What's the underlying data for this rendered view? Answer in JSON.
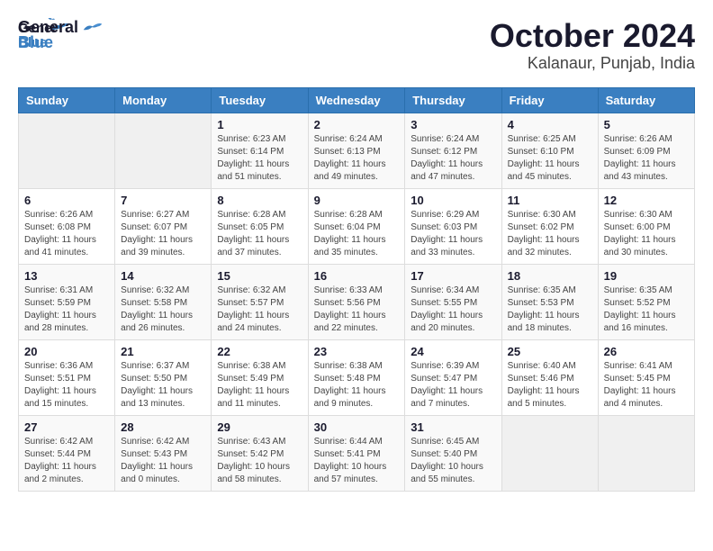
{
  "header": {
    "logo_general": "General",
    "logo_blue": "Blue",
    "month_title": "October 2024",
    "location": "Kalanaur, Punjab, India"
  },
  "weekdays": [
    "Sunday",
    "Monday",
    "Tuesday",
    "Wednesday",
    "Thursday",
    "Friday",
    "Saturday"
  ],
  "weeks": [
    [
      {
        "day": "",
        "sunrise": "",
        "sunset": "",
        "daylight": ""
      },
      {
        "day": "",
        "sunrise": "",
        "sunset": "",
        "daylight": ""
      },
      {
        "day": "1",
        "sunrise": "Sunrise: 6:23 AM",
        "sunset": "Sunset: 6:14 PM",
        "daylight": "Daylight: 11 hours and 51 minutes."
      },
      {
        "day": "2",
        "sunrise": "Sunrise: 6:24 AM",
        "sunset": "Sunset: 6:13 PM",
        "daylight": "Daylight: 11 hours and 49 minutes."
      },
      {
        "day": "3",
        "sunrise": "Sunrise: 6:24 AM",
        "sunset": "Sunset: 6:12 PM",
        "daylight": "Daylight: 11 hours and 47 minutes."
      },
      {
        "day": "4",
        "sunrise": "Sunrise: 6:25 AM",
        "sunset": "Sunset: 6:10 PM",
        "daylight": "Daylight: 11 hours and 45 minutes."
      },
      {
        "day": "5",
        "sunrise": "Sunrise: 6:26 AM",
        "sunset": "Sunset: 6:09 PM",
        "daylight": "Daylight: 11 hours and 43 minutes."
      }
    ],
    [
      {
        "day": "6",
        "sunrise": "Sunrise: 6:26 AM",
        "sunset": "Sunset: 6:08 PM",
        "daylight": "Daylight: 11 hours and 41 minutes."
      },
      {
        "day": "7",
        "sunrise": "Sunrise: 6:27 AM",
        "sunset": "Sunset: 6:07 PM",
        "daylight": "Daylight: 11 hours and 39 minutes."
      },
      {
        "day": "8",
        "sunrise": "Sunrise: 6:28 AM",
        "sunset": "Sunset: 6:05 PM",
        "daylight": "Daylight: 11 hours and 37 minutes."
      },
      {
        "day": "9",
        "sunrise": "Sunrise: 6:28 AM",
        "sunset": "Sunset: 6:04 PM",
        "daylight": "Daylight: 11 hours and 35 minutes."
      },
      {
        "day": "10",
        "sunrise": "Sunrise: 6:29 AM",
        "sunset": "Sunset: 6:03 PM",
        "daylight": "Daylight: 11 hours and 33 minutes."
      },
      {
        "day": "11",
        "sunrise": "Sunrise: 6:30 AM",
        "sunset": "Sunset: 6:02 PM",
        "daylight": "Daylight: 11 hours and 32 minutes."
      },
      {
        "day": "12",
        "sunrise": "Sunrise: 6:30 AM",
        "sunset": "Sunset: 6:00 PM",
        "daylight": "Daylight: 11 hours and 30 minutes."
      }
    ],
    [
      {
        "day": "13",
        "sunrise": "Sunrise: 6:31 AM",
        "sunset": "Sunset: 5:59 PM",
        "daylight": "Daylight: 11 hours and 28 minutes."
      },
      {
        "day": "14",
        "sunrise": "Sunrise: 6:32 AM",
        "sunset": "Sunset: 5:58 PM",
        "daylight": "Daylight: 11 hours and 26 minutes."
      },
      {
        "day": "15",
        "sunrise": "Sunrise: 6:32 AM",
        "sunset": "Sunset: 5:57 PM",
        "daylight": "Daylight: 11 hours and 24 minutes."
      },
      {
        "day": "16",
        "sunrise": "Sunrise: 6:33 AM",
        "sunset": "Sunset: 5:56 PM",
        "daylight": "Daylight: 11 hours and 22 minutes."
      },
      {
        "day": "17",
        "sunrise": "Sunrise: 6:34 AM",
        "sunset": "Sunset: 5:55 PM",
        "daylight": "Daylight: 11 hours and 20 minutes."
      },
      {
        "day": "18",
        "sunrise": "Sunrise: 6:35 AM",
        "sunset": "Sunset: 5:53 PM",
        "daylight": "Daylight: 11 hours and 18 minutes."
      },
      {
        "day": "19",
        "sunrise": "Sunrise: 6:35 AM",
        "sunset": "Sunset: 5:52 PM",
        "daylight": "Daylight: 11 hours and 16 minutes."
      }
    ],
    [
      {
        "day": "20",
        "sunrise": "Sunrise: 6:36 AM",
        "sunset": "Sunset: 5:51 PM",
        "daylight": "Daylight: 11 hours and 15 minutes."
      },
      {
        "day": "21",
        "sunrise": "Sunrise: 6:37 AM",
        "sunset": "Sunset: 5:50 PM",
        "daylight": "Daylight: 11 hours and 13 minutes."
      },
      {
        "day": "22",
        "sunrise": "Sunrise: 6:38 AM",
        "sunset": "Sunset: 5:49 PM",
        "daylight": "Daylight: 11 hours and 11 minutes."
      },
      {
        "day": "23",
        "sunrise": "Sunrise: 6:38 AM",
        "sunset": "Sunset: 5:48 PM",
        "daylight": "Daylight: 11 hours and 9 minutes."
      },
      {
        "day": "24",
        "sunrise": "Sunrise: 6:39 AM",
        "sunset": "Sunset: 5:47 PM",
        "daylight": "Daylight: 11 hours and 7 minutes."
      },
      {
        "day": "25",
        "sunrise": "Sunrise: 6:40 AM",
        "sunset": "Sunset: 5:46 PM",
        "daylight": "Daylight: 11 hours and 5 minutes."
      },
      {
        "day": "26",
        "sunrise": "Sunrise: 6:41 AM",
        "sunset": "Sunset: 5:45 PM",
        "daylight": "Daylight: 11 hours and 4 minutes."
      }
    ],
    [
      {
        "day": "27",
        "sunrise": "Sunrise: 6:42 AM",
        "sunset": "Sunset: 5:44 PM",
        "daylight": "Daylight: 11 hours and 2 minutes."
      },
      {
        "day": "28",
        "sunrise": "Sunrise: 6:42 AM",
        "sunset": "Sunset: 5:43 PM",
        "daylight": "Daylight: 11 hours and 0 minutes."
      },
      {
        "day": "29",
        "sunrise": "Sunrise: 6:43 AM",
        "sunset": "Sunset: 5:42 PM",
        "daylight": "Daylight: 10 hours and 58 minutes."
      },
      {
        "day": "30",
        "sunrise": "Sunrise: 6:44 AM",
        "sunset": "Sunset: 5:41 PM",
        "daylight": "Daylight: 10 hours and 57 minutes."
      },
      {
        "day": "31",
        "sunrise": "Sunrise: 6:45 AM",
        "sunset": "Sunset: 5:40 PM",
        "daylight": "Daylight: 10 hours and 55 minutes."
      },
      {
        "day": "",
        "sunrise": "",
        "sunset": "",
        "daylight": ""
      },
      {
        "day": "",
        "sunrise": "",
        "sunset": "",
        "daylight": ""
      }
    ]
  ]
}
